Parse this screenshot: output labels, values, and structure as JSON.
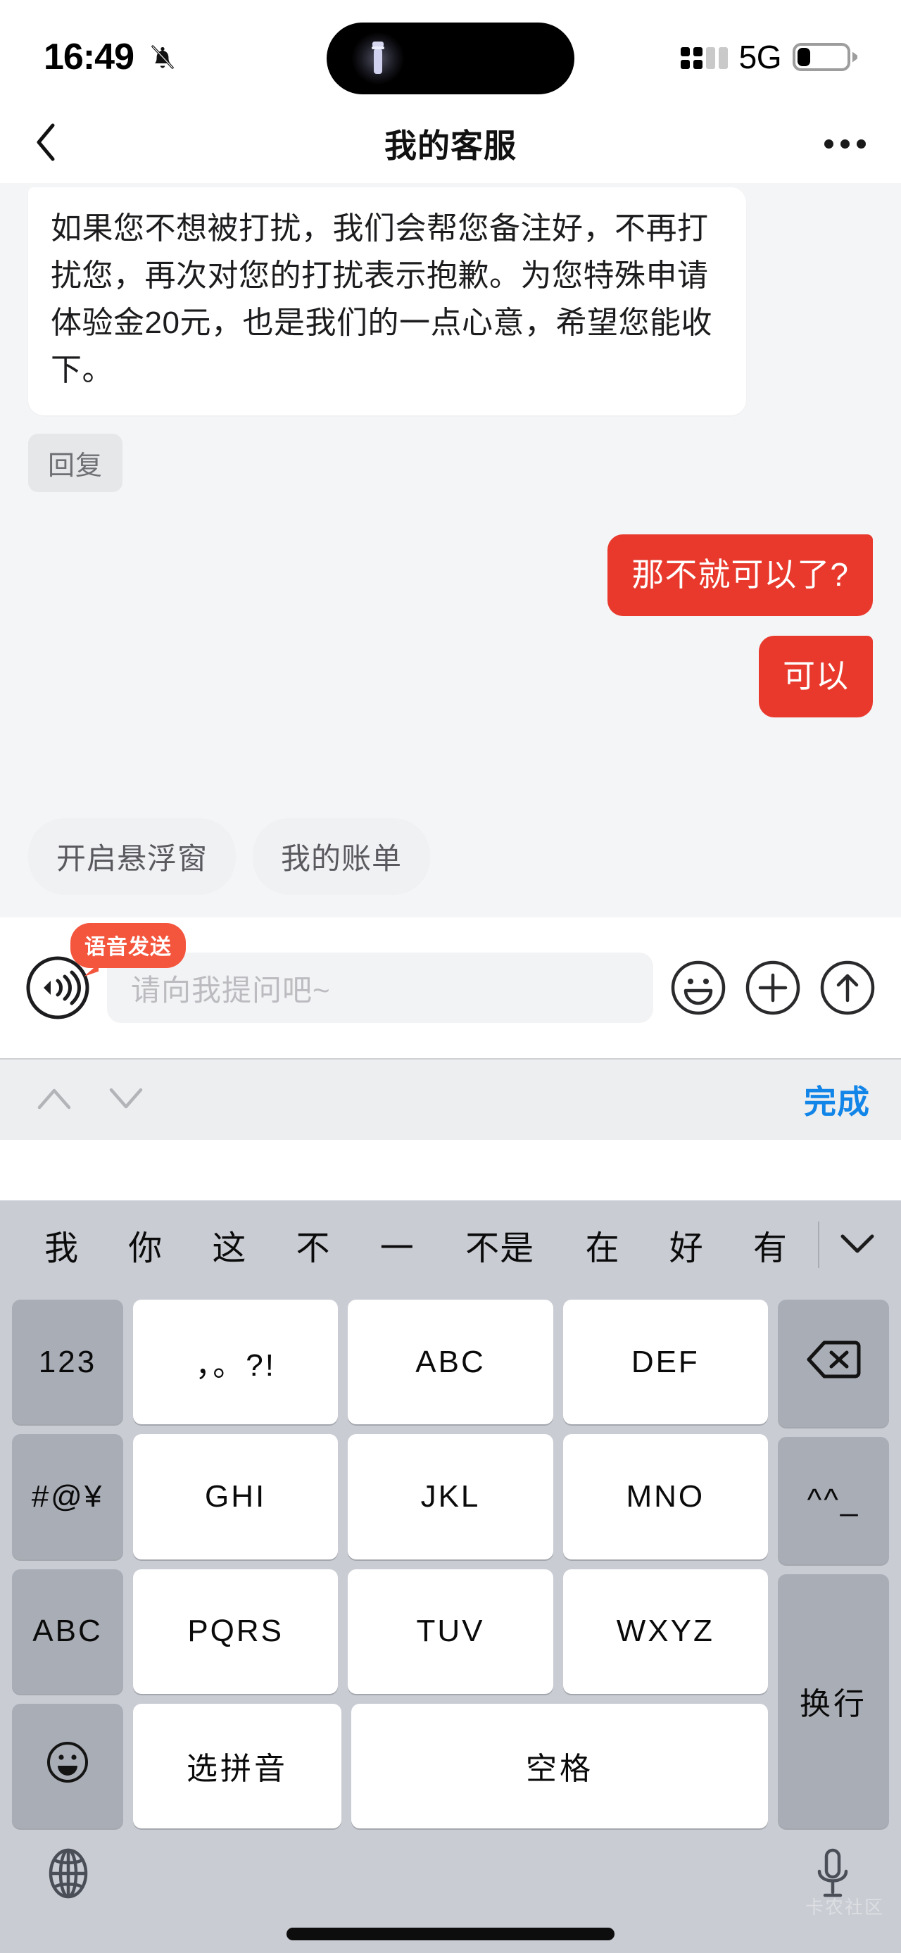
{
  "status_bar": {
    "time": "16:49",
    "bell_icon": "bell-mute-icon",
    "island_icon": "flashlight-icon",
    "network": "5G",
    "signal_icon": "signal-dots-icon",
    "battery_icon": "battery-low-icon",
    "battery_level_pct": 25
  },
  "nav": {
    "back_icon": "chevron-left-icon",
    "title": "我的客服",
    "more_icon": "ellipsis-icon"
  },
  "chat": {
    "incoming_message": "如果您不想被打扰，我们会帮您备注好，不再打扰您，再次对您的打扰表示抱歉。为您特殊申请体验金20元，也是我们的一点心意，希望您能收下。",
    "reply_chip": "回复",
    "outgoing_messages": [
      "那不就可以了?",
      "可以"
    ],
    "quick_chips": [
      "开启悬浮窗",
      "我的账单"
    ],
    "bubble_color_out": "#e8392c",
    "bubble_color_in": "#ffffff",
    "background": "#f4f5f7"
  },
  "composer": {
    "voice_icon": "voice-wave-icon",
    "voice_badge": "语音发送",
    "placeholder": "请向我提问吧~",
    "emoji_icon": "smiley-circle-icon",
    "plus_icon": "plus-circle-icon",
    "send_icon": "arrow-up-circle-icon"
  },
  "keyboard_accessory": {
    "prev_icon": "chevron-up-icon",
    "next_icon": "chevron-down-icon",
    "done_label": "完成",
    "done_color": "#1285e8"
  },
  "keyboard": {
    "candidates": [
      "我",
      "你",
      "这",
      "不",
      "一",
      "不是",
      "在",
      "好",
      "有"
    ],
    "expand_icon": "chevron-down-icon",
    "left_column": [
      "123",
      "#@¥",
      "ABC",
      "emoji-face-icon"
    ],
    "grid": [
      [
        "，。?!",
        "ABC",
        "DEF"
      ],
      [
        "GHI",
        "JKL",
        "MNO"
      ],
      [
        "PQRS",
        "TUV",
        "WXYZ"
      ],
      [
        "选拼音",
        "空格"
      ]
    ],
    "right_column": [
      "backspace-icon",
      "^^_",
      "换行"
    ],
    "bottom": {
      "globe_icon": "globe-icon",
      "mic_icon": "microphone-icon"
    },
    "watermark": "卡农社区"
  }
}
